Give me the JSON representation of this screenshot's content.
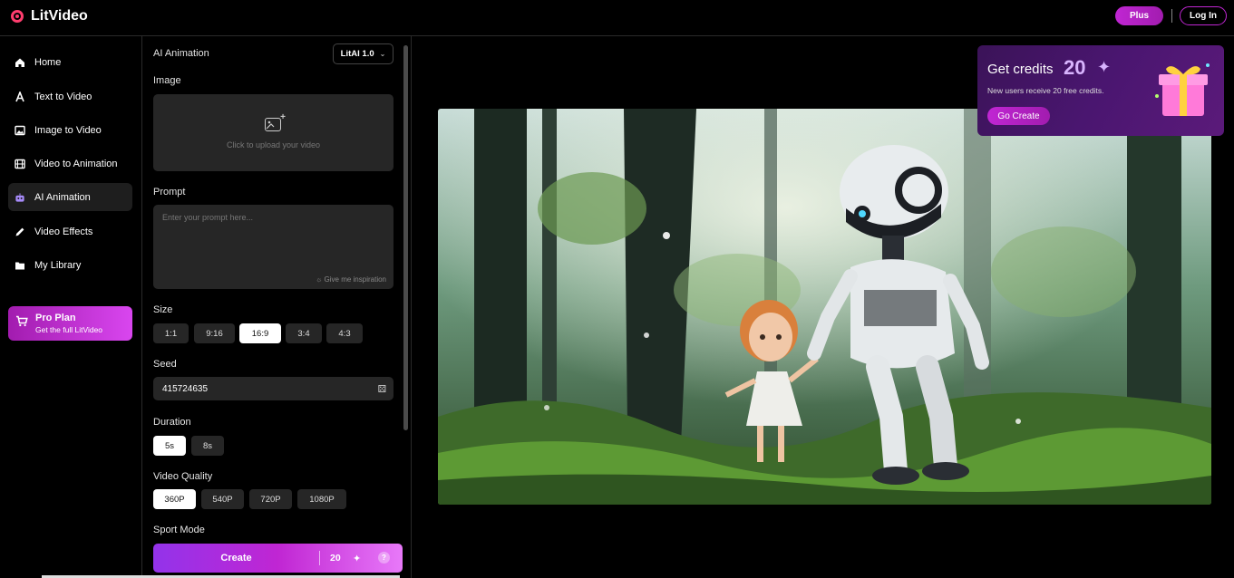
{
  "app": {
    "name": "LitVideo"
  },
  "header": {
    "plus_label": "Plus",
    "login_label": "Log In"
  },
  "sidebar": {
    "items": [
      {
        "label": "Home",
        "icon": "home-icon"
      },
      {
        "label": "Text to Video",
        "icon": "text-icon"
      },
      {
        "label": "Image to Video",
        "icon": "image-icon"
      },
      {
        "label": "Video to Animation",
        "icon": "film-icon"
      },
      {
        "label": "AI Animation",
        "icon": "robot-icon",
        "active": true
      },
      {
        "label": "Video Effects",
        "icon": "pen-icon"
      },
      {
        "label": "My Library",
        "icon": "folder-icon"
      }
    ],
    "pro_plan": {
      "title": "Pro Plan",
      "subtitle": "Get the full LitVideo"
    }
  },
  "panel": {
    "title": "AI Animation",
    "model": "LitAI 1.0",
    "image_label": "Image",
    "upload_text": "Click to upload your video",
    "prompt_label": "Prompt",
    "prompt_placeholder": "Enter your prompt here...",
    "inspiration": "Give me inspiration",
    "size_label": "Size",
    "sizes": [
      "1:1",
      "9:16",
      "16:9",
      "3:4",
      "4:3"
    ],
    "size_selected": "16:9",
    "seed_label": "Seed",
    "seed_value": "415724635",
    "duration_label": "Duration",
    "durations": [
      "5s",
      "8s"
    ],
    "quality_label": "Video Quality",
    "qualities": [
      "360P",
      "540P",
      "720P",
      "1080P"
    ],
    "sport_label": "Sport Mode",
    "create": {
      "label": "Create",
      "cost": "20"
    }
  },
  "promo": {
    "heading": "Get credits",
    "amount": "20",
    "subtitle": "New users receive 20 free credits.",
    "cta": "Go Create"
  },
  "colors": {
    "accent": "#c026d3",
    "panel_bg": "#262626"
  }
}
